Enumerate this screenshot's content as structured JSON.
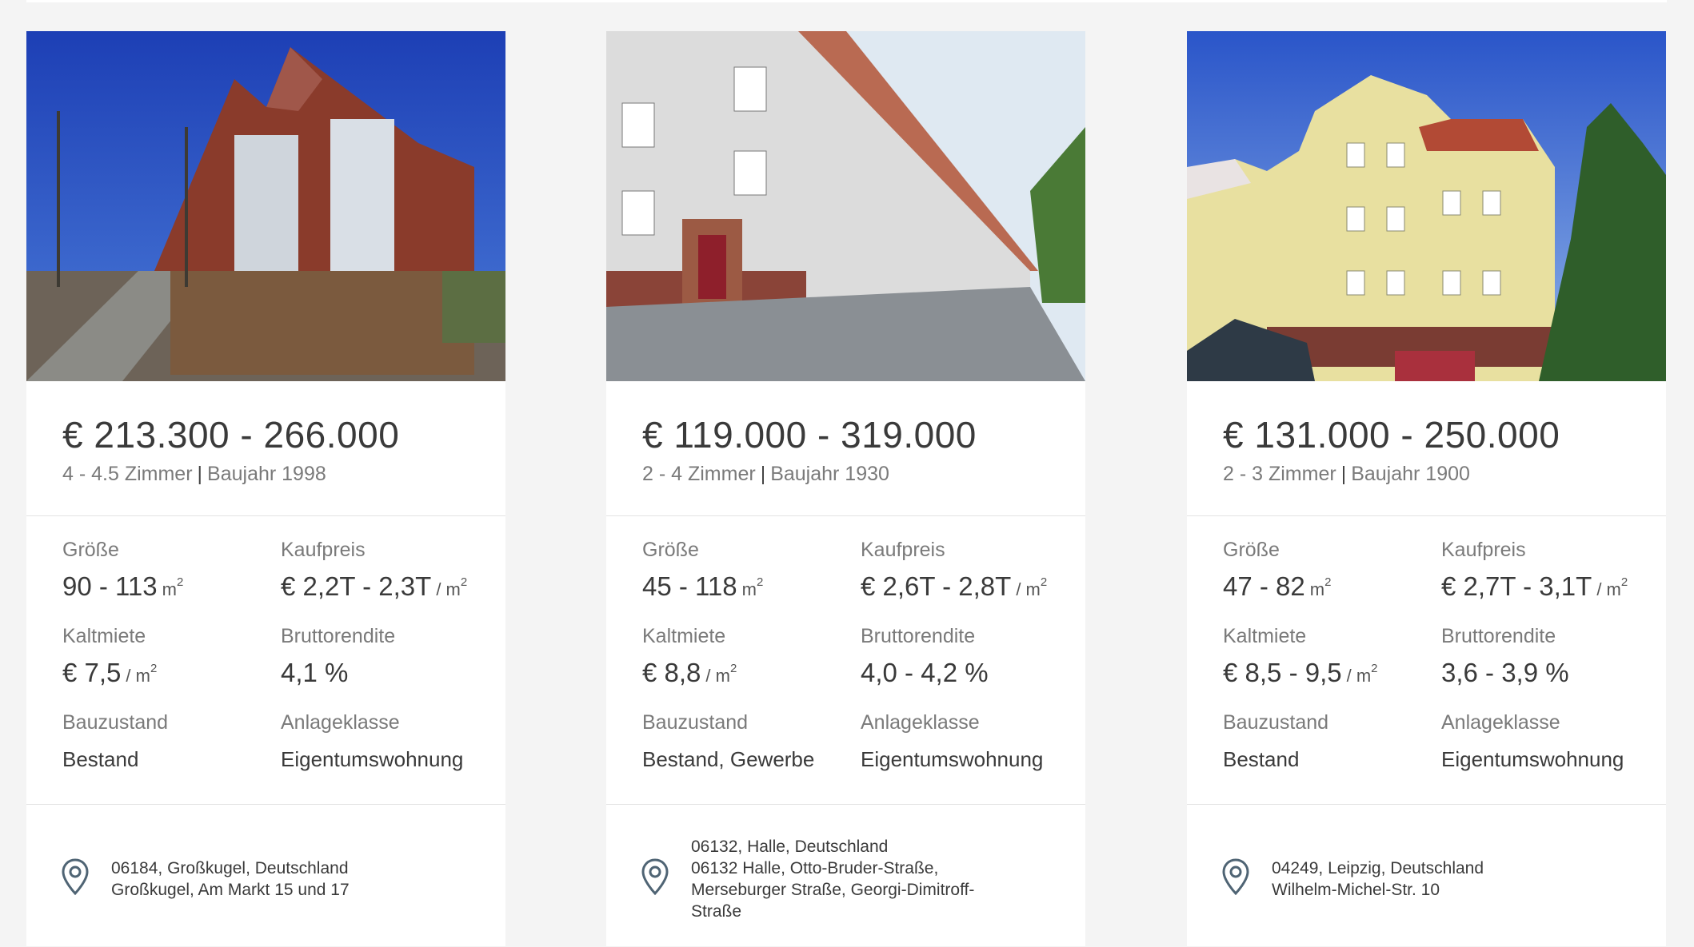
{
  "cards": [
    {
      "price": "€ 213.300 - 266.000",
      "rooms": "4 - 4.5 Zimmer",
      "year": "Baujahr 1998",
      "size_label": "Größe",
      "size_value": "90 - 113",
      "purchase_label": "Kaufpreis",
      "purchase_value": "€ 2,2T - 2,3T",
      "rent_label": "Kaltmiete",
      "rent_value": "€ 7,5",
      "yield_label": "Bruttorendite",
      "yield_value": "4,1 %",
      "condition_label": "Bauzustand",
      "condition_value": "Bestand",
      "class_label": "Anlageklasse",
      "class_value": "Eigentumswohnung",
      "address_lines": [
        "06184, Großkugel, Deutschland",
        "Großkugel, Am Markt 15 und 17"
      ]
    },
    {
      "price": "€ 119.000 - 319.000",
      "rooms": "2 - 4 Zimmer",
      "year": "Baujahr 1930",
      "size_label": "Größe",
      "size_value": "45 - 118",
      "purchase_label": "Kaufpreis",
      "purchase_value": "€ 2,6T - 2,8T",
      "rent_label": "Kaltmiete",
      "rent_value": "€ 8,8",
      "yield_label": "Bruttorendite",
      "yield_value": "4,0 - 4,2 %",
      "condition_label": "Bauzustand",
      "condition_value": "Bestand, Gewerbe",
      "class_label": "Anlageklasse",
      "class_value": "Eigentumswohnung",
      "address_lines": [
        "06132, Halle, Deutschland",
        "06132 Halle, Otto-Bruder-Straße,",
        "Merseburger Straße, Georgi-Dimitroff-",
        "Straße"
      ]
    },
    {
      "price": "€ 131.000 - 250.000",
      "rooms": "2 - 3 Zimmer",
      "year": "Baujahr 1900",
      "size_label": "Größe",
      "size_value": "47 - 82",
      "purchase_label": "Kaufpreis",
      "purchase_value": "€ 2,7T - 3,1T",
      "rent_label": "Kaltmiete",
      "rent_value": "€ 8,5 - 9,5",
      "yield_label": "Bruttorendite",
      "yield_value": "3,6 - 3,9 %",
      "condition_label": "Bauzustand",
      "condition_value": "Bestand",
      "class_label": "Anlageklasse",
      "class_value": "Eigentumswohnung",
      "address_lines": [
        "04249, Leipzig, Deutschland",
        "Wilhelm-Michel-Str. 10"
      ]
    }
  ],
  "units": {
    "area": "m",
    "per_area": "/ m",
    "exponent": "2"
  },
  "icons": {
    "photo": "building-photo",
    "location": "map-pin-icon"
  },
  "colors": {
    "pin": "#4f6474",
    "sky": "#2a55c9"
  }
}
